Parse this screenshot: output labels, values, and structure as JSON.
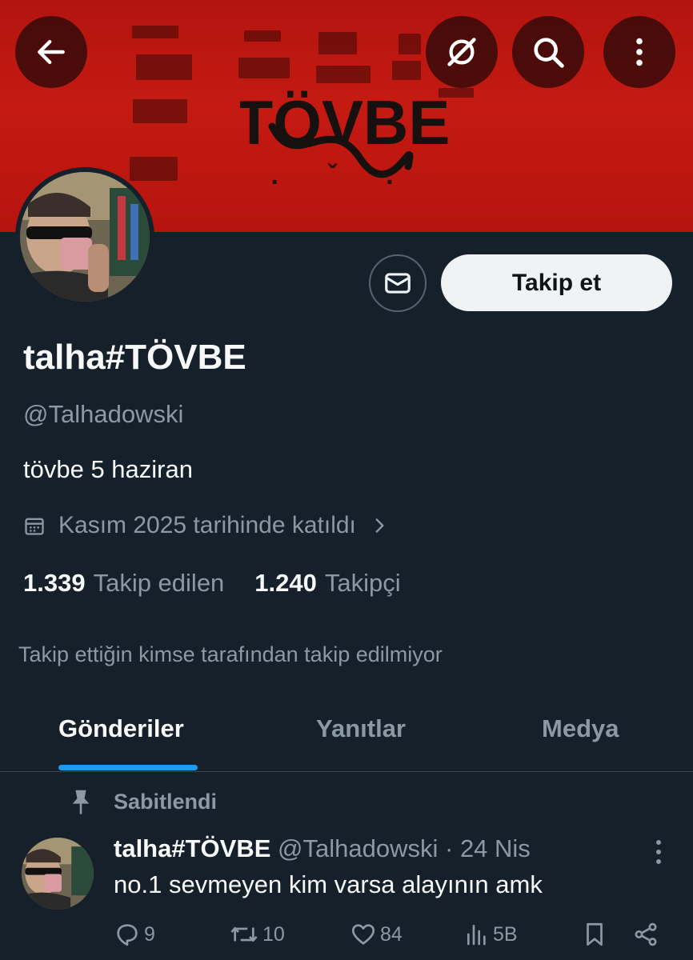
{
  "profile": {
    "display_name": "talha#TÖVBE",
    "handle": "@Talhadowski",
    "bio": "tövbe 5 haziran",
    "joined": "Kasım 2025 tarihinde katıldı",
    "following_count": "1.339",
    "following_label": "Takip edilen",
    "followers_count": "1.240",
    "followers_label": "Takipçi",
    "not_followed_note": "Takip ettiğin kimse tarafından takip edilmiyor"
  },
  "banner": {
    "title": "TÖVBE",
    "back_icon": "arrow-left-icon",
    "grok_icon": "grok-icon",
    "search_icon": "search-icon",
    "more_icon": "more-vertical-icon"
  },
  "actions": {
    "message_icon": "envelope-icon",
    "follow_label": "Takip et"
  },
  "tabs": [
    {
      "label": "Gönderiler",
      "active": true
    },
    {
      "label": "Yanıtlar",
      "active": false
    },
    {
      "label": "Medya",
      "active": false
    }
  ],
  "pinned_post": {
    "pinned_label": "Sabitlendi",
    "author_name": "talha#TÖVBE",
    "author_handle": "@Talhadowski",
    "separator": "·",
    "date": "24 Nis",
    "text": "no.1 sevmeyen kim varsa alayının amk",
    "replies": "9",
    "reposts": "10",
    "likes": "84",
    "views": "5B"
  },
  "colors": {
    "background": "#15202b",
    "accent": "#1d9bf0",
    "banner_red": "#c41a12",
    "muted_text": "#8b98a5"
  }
}
